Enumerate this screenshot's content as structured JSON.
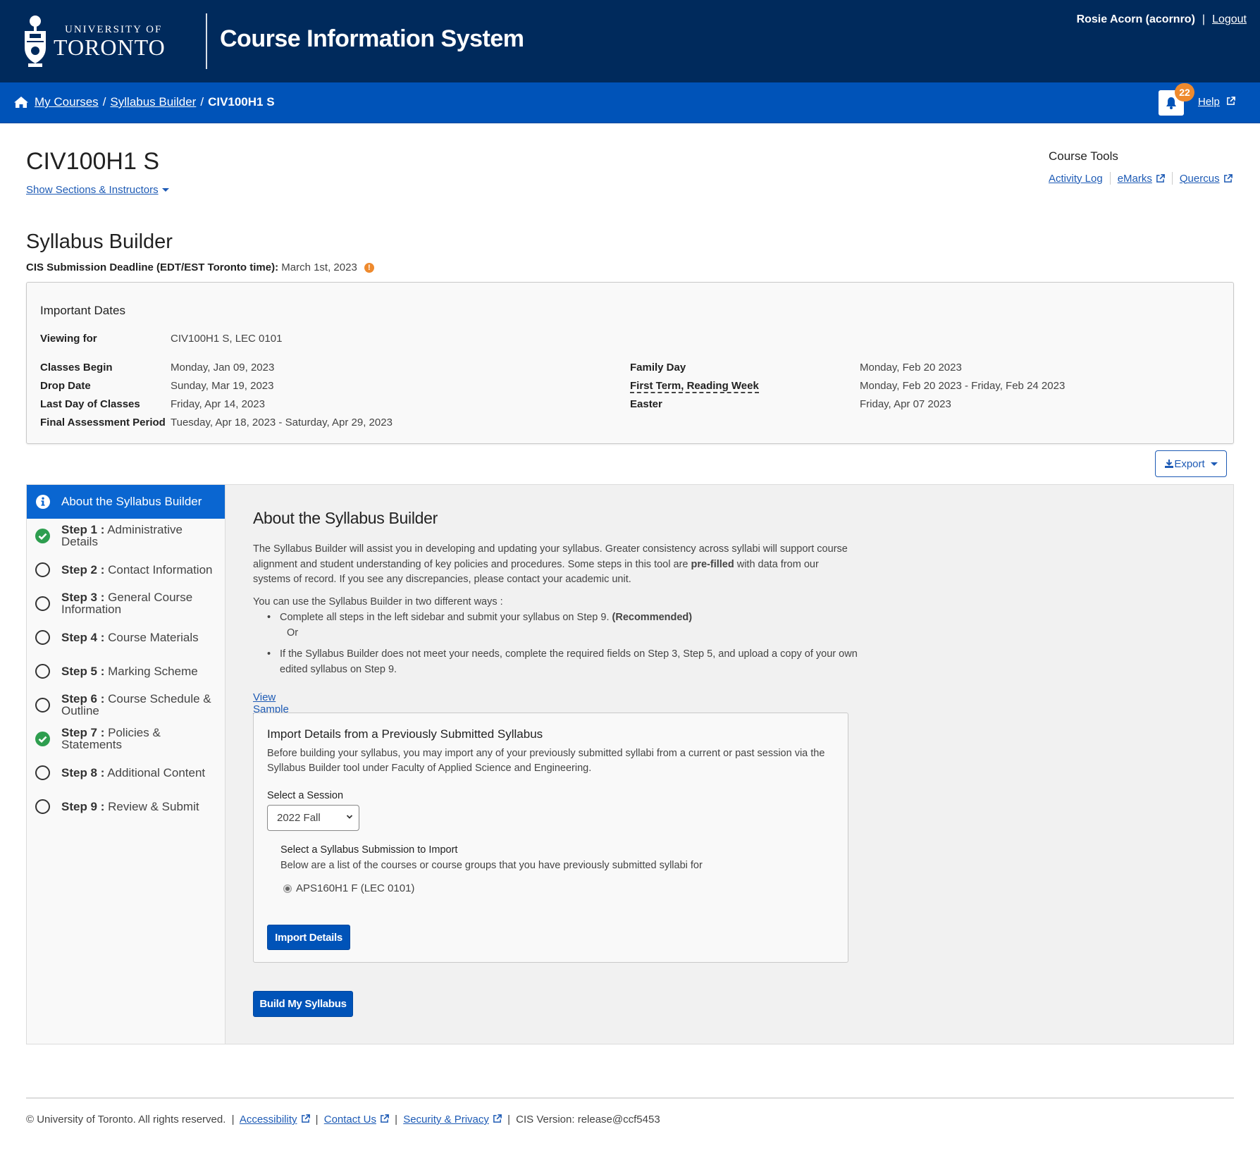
{
  "header": {
    "logo_line1": "UNIVERSITY OF",
    "logo_line2": "TORONTO",
    "app_title": "Course Information System",
    "user_name": "Rosie Acorn (acornro)",
    "separator": "|",
    "logout_label": "Logout"
  },
  "breadcrumb": {
    "items": [
      {
        "label": "My Courses",
        "link": true
      },
      {
        "label": "Syllabus Builder",
        "link": true
      },
      {
        "label": "CIV100H1 S",
        "link": false
      }
    ],
    "separator": "/",
    "notification_count": "22",
    "help_label": "Help"
  },
  "course": {
    "title": "CIV100H1 S",
    "show_sections_label": "Show Sections & Instructors"
  },
  "course_tools": {
    "heading": "Course Tools",
    "links": [
      {
        "label": "Activity Log",
        "external": false
      },
      {
        "label": "eMarks",
        "external": true
      },
      {
        "label": "Quercus",
        "external": true
      }
    ]
  },
  "syllabus_builder": {
    "title": "Syllabus Builder",
    "deadline_label": "CIS Submission Deadline (EDT/EST Toronto time):",
    "deadline_value": "March 1st, 2023",
    "deadline_icon": "!"
  },
  "important_dates": {
    "heading": "Important Dates",
    "viewing_for_label": "Viewing for",
    "viewing_for_value": "CIV100H1 S, LEC 0101",
    "left": [
      {
        "label": "Classes Begin",
        "value": "Monday, Jan 09, 2023"
      },
      {
        "label": "Drop Date",
        "value": "Sunday, Mar 19, 2023"
      },
      {
        "label": "Last Day of Classes",
        "value": "Friday, Apr 14, 2023"
      },
      {
        "label": "Final Assessment Period",
        "value": "Tuesday, Apr 18, 2023 - Saturday, Apr 29, 2023"
      }
    ],
    "right": [
      {
        "label": "Family Day",
        "value": "Monday, Feb 20 2023"
      },
      {
        "label": "First Term, Reading Week",
        "value": "Monday, Feb 20 2023 - Friday, Feb 24 2023"
      },
      {
        "label": "Easter",
        "value": "Friday, Apr 07 2023"
      }
    ]
  },
  "export_label": "Export",
  "sidebar": {
    "active": {
      "label": "About the Syllabus Builder",
      "icon": "info-icon"
    },
    "steps": [
      {
        "step": "Step 1 :",
        "label": "Administrative Details",
        "status": "complete"
      },
      {
        "step": "Step 2 :",
        "label": "Contact Information",
        "status": "incomplete"
      },
      {
        "step": "Step 3 :",
        "label": "General Course Information",
        "status": "incomplete"
      },
      {
        "step": "Step 4 :",
        "label": "Course Materials",
        "status": "incomplete"
      },
      {
        "step": "Step 5 :",
        "label": "Marking Scheme",
        "status": "incomplete"
      },
      {
        "step": "Step 6 :",
        "label": "Course Schedule & Outline",
        "status": "incomplete"
      },
      {
        "step": "Step 7 :",
        "label": "Policies & Statements",
        "status": "complete"
      },
      {
        "step": "Step 8 :",
        "label": "Additional Content",
        "status": "incomplete"
      },
      {
        "step": "Step 9 :",
        "label": "Review & Submit",
        "status": "incomplete"
      }
    ]
  },
  "about": {
    "heading": "About the Syllabus Builder",
    "intro_before_bold": "The Syllabus Builder will assist you in developing and updating your syllabus. Greater consistency across syllabi will support course alignment and student understanding of key policies and procedures. Some steps in this tool are ",
    "intro_bold": "pre-filled",
    "intro_after_bold": " with data from our systems of record. If you see any discrepancies, please contact your academic unit.",
    "ways_intro": "You can use the Syllabus Builder in two different ways :",
    "way1": "Complete all steps in the left sidebar and submit your syllabus on Step 9. ",
    "way1_bold": "(Recommended)",
    "or_label": "Or",
    "way2": "If the Syllabus Builder does not meet your needs, complete the required fields on Step 3, Step 5, and upload a copy of your own edited syllabus on Step 9.",
    "sample_link": "View Sample Syllabus"
  },
  "import": {
    "heading": "Import Details from a Previously Submitted Syllabus",
    "description": "Before building your syllabus, you may import any of your previously submitted syllabi from a current or past session via the Syllabus Builder tool under Faculty of Applied Science and Engineering.",
    "session_label": "Select a Session",
    "session_value": "2022 Fall",
    "submission_heading": "Select a Syllabus Submission to Import",
    "submission_desc": "Below are a list of the courses or course groups that you have previously submitted syllabi for",
    "options": [
      {
        "label": "APS160H1 F (LEC 0101)",
        "selected": true
      }
    ],
    "import_button": "Import Details"
  },
  "build_button": "Build My Syllabus",
  "footer": {
    "copyright": "© University of Toronto. All rights reserved.",
    "links": [
      "Accessibility",
      "Contact Us",
      "Security & Privacy"
    ],
    "version": "CIS Version: release@ccf5453",
    "separator": "|"
  },
  "colors": {
    "header_bg": "#002a5c",
    "breadcrumb_bg": "#0053b8",
    "active_nav": "#0a66d1",
    "link": "#1e5bb5",
    "success": "#2e9e4f",
    "warning": "#ee8a2e"
  }
}
